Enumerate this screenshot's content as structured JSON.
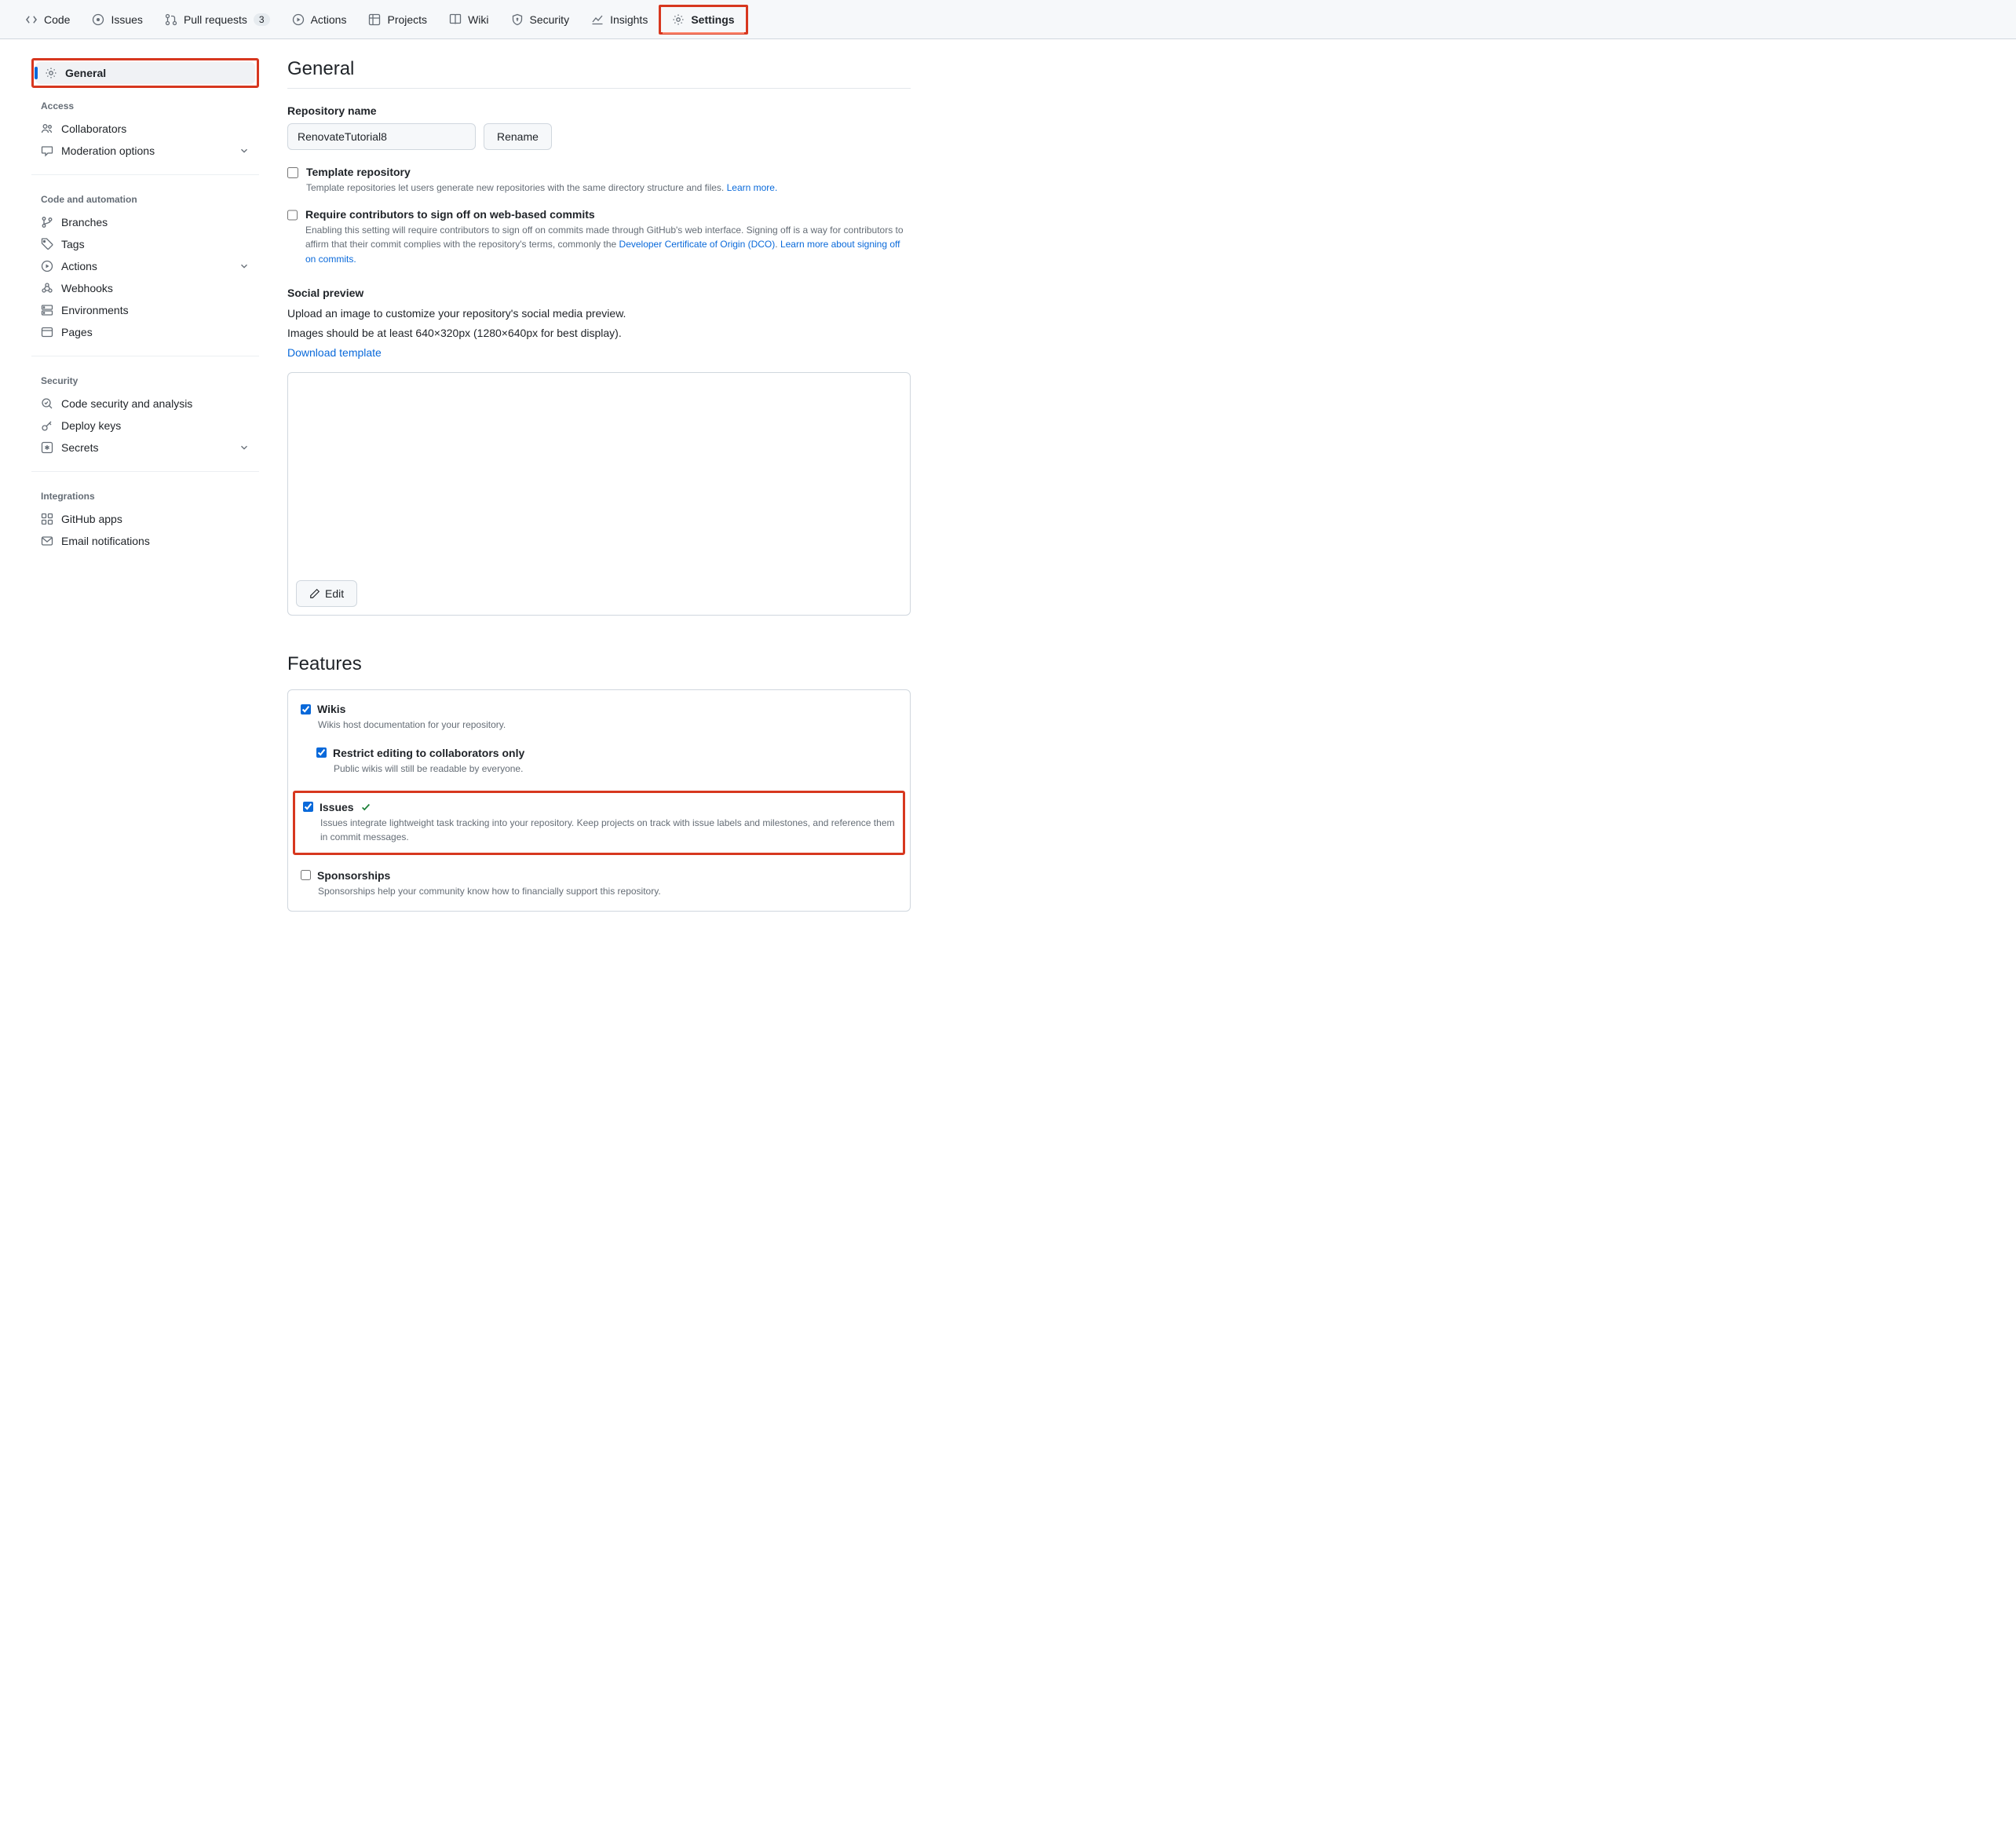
{
  "topnav": {
    "items": [
      {
        "label": "Code",
        "counter": null
      },
      {
        "label": "Issues",
        "counter": null
      },
      {
        "label": "Pull requests",
        "counter": "3"
      },
      {
        "label": "Actions",
        "counter": null
      },
      {
        "label": "Projects",
        "counter": null
      },
      {
        "label": "Wiki",
        "counter": null
      },
      {
        "label": "Security",
        "counter": null
      },
      {
        "label": "Insights",
        "counter": null
      },
      {
        "label": "Settings",
        "counter": null
      }
    ]
  },
  "sidebar": {
    "general": "General",
    "g_access": "Access",
    "collaborators": "Collaborators",
    "moderation": "Moderation options",
    "g_code": "Code and automation",
    "branches": "Branches",
    "tags": "Tags",
    "actions": "Actions",
    "webhooks": "Webhooks",
    "environments": "Environments",
    "pages": "Pages",
    "g_security": "Security",
    "codesec": "Code security and analysis",
    "deploykeys": "Deploy keys",
    "secrets": "Secrets",
    "g_integrations": "Integrations",
    "ghapps": "GitHub apps",
    "emailnotif": "Email notifications"
  },
  "main": {
    "title": "General",
    "repo_name_label": "Repository name",
    "repo_name_value": "RenovateTutorial8",
    "rename_btn": "Rename",
    "template_title": "Template repository",
    "template_desc": "Template repositories let users generate new repositories with the same directory structure and files. ",
    "template_learn": "Learn more.",
    "signoff_title": "Require contributors to sign off on web-based commits",
    "signoff_desc1": "Enabling this setting will require contributors to sign off on commits made through GitHub's web interface. Signing off is a way for contributors to affirm that their commit complies with the repository's terms, commonly the ",
    "signoff_link1": "Developer Certificate of Origin (DCO)",
    "signoff_desc2": ". ",
    "signoff_link2": "Learn more about signing off on commits.",
    "social_head": "Social preview",
    "social_p1": "Upload an image to customize your repository's social media preview.",
    "social_p2": "Images should be at least 640×320px (1280×640px for best display).",
    "social_download": "Download template",
    "edit_btn": "Edit",
    "features_head": "Features",
    "f_wikis_title": "Wikis",
    "f_wikis_desc": "Wikis host documentation for your repository.",
    "f_restrict_title": "Restrict editing to collaborators only",
    "f_restrict_desc": "Public wikis will still be readable by everyone.",
    "f_issues_title": "Issues",
    "f_issues_desc": "Issues integrate lightweight task tracking into your repository. Keep projects on track with issue labels and milestones, and reference them in commit messages.",
    "f_sponsor_title": "Sponsorships",
    "f_sponsor_desc": "Sponsorships help your community know how to financially support this repository."
  }
}
